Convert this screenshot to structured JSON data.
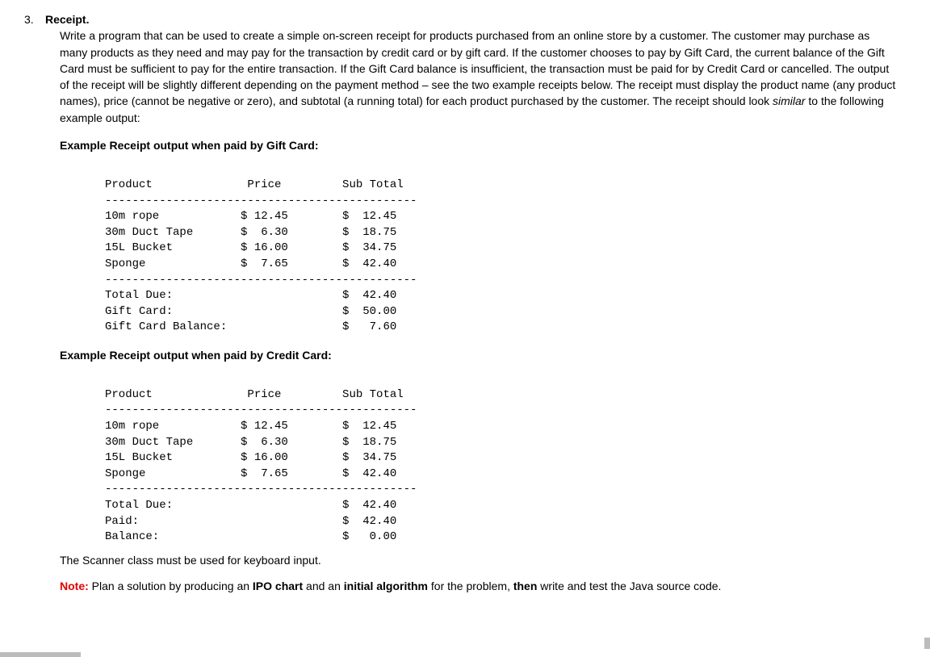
{
  "question": {
    "number": "3.",
    "title": "Receipt."
  },
  "description": {
    "p1_a": "Write a program that can be used to create a simple on-screen receipt for products purchased from an online store by a customer. The customer may purchase as many products as they need and may pay for the transaction by credit card or by gift card. If the customer chooses to pay by Gift Card, the current balance of the Gift Card must be sufficient to pay for the entire transaction. If the Gift Card balance is insufficient, the transaction must be paid for by Credit Card or cancelled. The output of the receipt will be slightly different depending on the payment method – see the two example receipts below. The receipt must display the product name (any product names), price (cannot be negative or zero), and subtotal (a running total) for each product purchased by the customer. The receipt should look ",
    "p1_similar": "similar",
    "p1_b": " to the following example output:"
  },
  "headings": {
    "example_gift": "Example Receipt output when paid by Gift Card:",
    "example_credit": "Example Receipt output when paid by Credit Card:"
  },
  "receipt_header": "Product              Price         Sub Total",
  "divider": "----------------------------------------------",
  "receipt_rows": [
    "10m rope            $ 12.45        $  12.45",
    "30m Duct Tape       $  6.30        $  18.75",
    "15L Bucket          $ 16.00        $  34.75",
    "Sponge              $  7.65        $  42.40"
  ],
  "gift_summary": [
    "Total Due:                         $  42.40",
    "Gift Card:                         $  50.00",
    "Gift Card Balance:                 $   7.60"
  ],
  "credit_summary": [
    "Total Due:                         $  42.40",
    "Paid:                              $  42.40",
    "Balance:                           $   0.00"
  ],
  "footer": {
    "scanner": "The Scanner class must be used for keyboard input.",
    "note_label": "Note:",
    "note_a": " Plan a solution by producing an ",
    "note_ipo": "IPO chart",
    "note_b": " and an ",
    "note_algo": "initial algorithm",
    "note_c": " for the problem, ",
    "note_then": "then",
    "note_d": " write and test the Java source code."
  },
  "chart_data": {
    "type": "table",
    "title": "Receipt examples",
    "columns": [
      "Product",
      "Price",
      "Sub Total"
    ],
    "rows": [
      {
        "Product": "10m rope",
        "Price": 12.45,
        "Sub Total": 12.45
      },
      {
        "Product": "30m Duct Tape",
        "Price": 6.3,
        "Sub Total": 18.75
      },
      {
        "Product": "15L Bucket",
        "Price": 16.0,
        "Sub Total": 34.75
      },
      {
        "Product": "Sponge",
        "Price": 7.65,
        "Sub Total": 42.4
      }
    ],
    "summaries": {
      "gift_card": {
        "Total Due": 42.4,
        "Gift Card": 50.0,
        "Gift Card Balance": 7.6
      },
      "credit_card": {
        "Total Due": 42.4,
        "Paid": 42.4,
        "Balance": 0.0
      }
    }
  }
}
